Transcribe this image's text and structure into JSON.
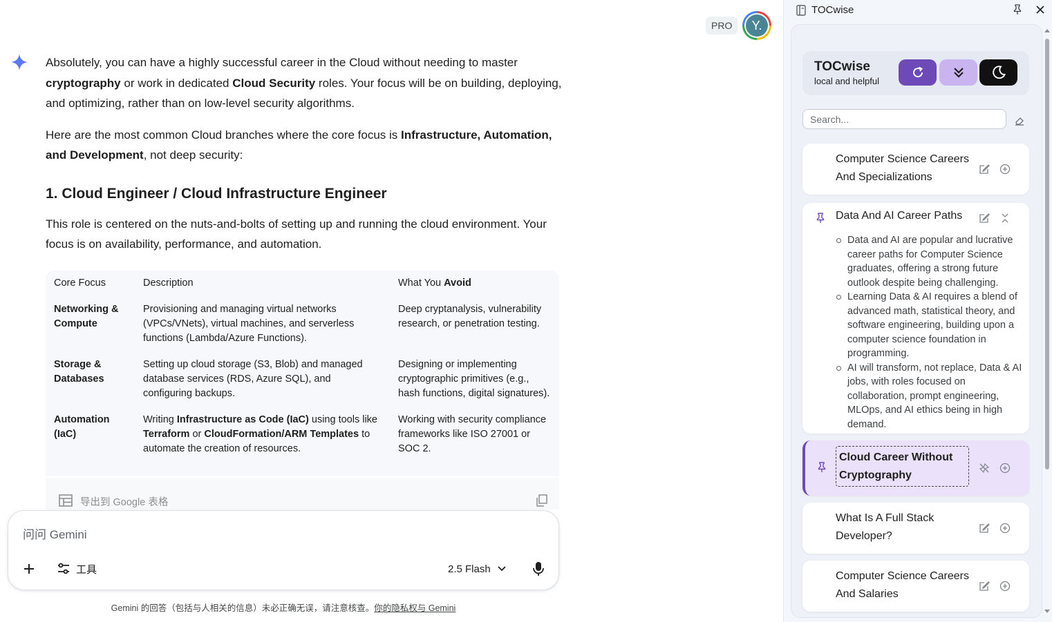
{
  "header": {
    "pro_badge": "PRO",
    "avatar_letter": "Y."
  },
  "answer": {
    "intro": {
      "t1": "Absolutely, you can have a highly successful career in the Cloud without needing to master ",
      "b1": "cryptography",
      "t2": " or work in dedicated ",
      "b2": "Cloud Security",
      "t3": " roles. Your focus will be on building, deploying, and optimizing, rather than on low-level security algorithms."
    },
    "branches": {
      "t1": "Here are the most common Cloud branches where the core focus is ",
      "b1": "Infrastructure, Automation, and Development",
      "t2": ", not deep security:"
    },
    "heading": "1. Cloud Engineer / Cloud Infrastructure Engineer",
    "role_desc": "This role is centered on the nuts-and-bolts of setting up and running the cloud environment. Your focus is on availability, performance, and automation."
  },
  "table": {
    "headers": {
      "c1": "Core Focus",
      "c2": "Description",
      "c3_plain": "What You ",
      "c3_bold": "Avoid"
    },
    "rows": [
      {
        "focus": "Networking & Compute",
        "desc": "Provisioning and managing virtual networks (VPCs/VNets), virtual machines, and serverless functions (Lambda/Azure Functions).",
        "avoid": "Deep cryptanalysis, vulnerability research, or penetration testing."
      },
      {
        "focus": "Storage & Databases",
        "desc": "Setting up cloud storage (S3, Blob) and managed database services (RDS, Azure SQL), and configuring backups.",
        "avoid": "Designing or implementing cryptographic primitives (e.g., hash functions, digital signatures)."
      },
      {
        "focus": "Automation (IaC)",
        "desc_parts": {
          "t1": "Writing ",
          "b1": "Infrastructure as Code (IaC)",
          "t2": " using tools like ",
          "b2": "Terraform",
          "t3": " or ",
          "b3": "CloudFormation/ARM Templates",
          "t4": " to automate the creation of resources."
        },
        "avoid": "Working with security compliance frameworks like ISO 27001 or SOC 2."
      }
    ],
    "export_label": "导出到 Google 表格"
  },
  "composer": {
    "placeholder": "问问 Gemini",
    "tools_label": "工具",
    "model_label": "2.5 Flash"
  },
  "footer": {
    "disclaimer": "Gemini 的回答（包括与人相关的信息）未必正确无误，请注意核查。",
    "privacy_link": "你的隐私权与 Gemini"
  },
  "panel": {
    "title": "TOCwise",
    "brand_name": "TOCwise",
    "brand_tagline": "local and helpful",
    "search_placeholder": "Search...",
    "items": [
      {
        "title": "Computer Science Careers And Specializations"
      },
      {
        "title": "Data And AI Career Paths",
        "bullets": [
          "Data and AI are popular and lucrative career paths for Computer Science graduates, offering a strong future outlook despite being challenging.",
          "Learning Data & AI requires a blend of advanced math, statistical theory, and software engineering, building upon a computer science foundation in programming.",
          "AI will transform, not replace, Data & AI jobs, with roles focused on collaboration, prompt engineering, MLOps, and AI ethics being in high demand."
        ]
      },
      {
        "title": "Cloud Career Without Cryptography"
      },
      {
        "title": "What Is A Full Stack Developer?"
      },
      {
        "title": "Computer Science Careers And Salaries"
      }
    ]
  },
  "colors": {
    "accent_purple": "#6e49b8",
    "accent_light_purple": "#c9b4f0",
    "dark_button": "#111111",
    "gemini_blue": "#4f7cf0"
  }
}
